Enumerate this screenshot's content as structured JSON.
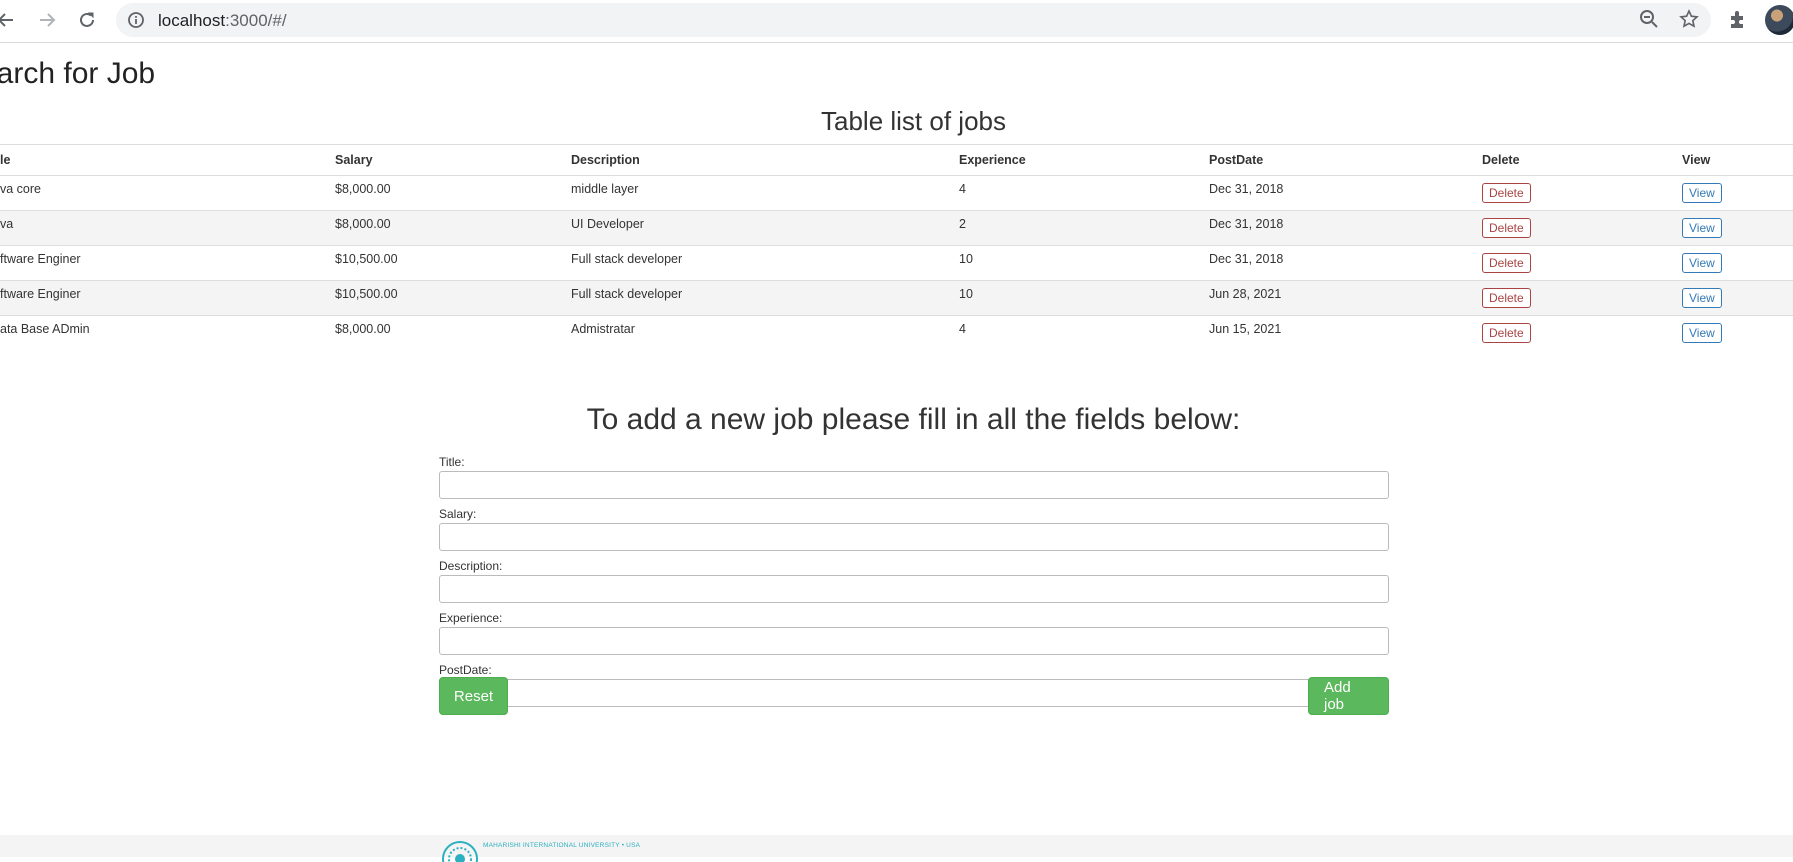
{
  "browser": {
    "url_host": "localhost",
    "url_rest": ":3000/#/",
    "icons": [
      "back-icon",
      "forward-icon",
      "reload-icon",
      "info-icon",
      "zoom-icon",
      "star-icon",
      "extensions-icon"
    ]
  },
  "page": {
    "heading": "earch for Job",
    "table_title": "Table list of jobs",
    "form_title": "To add a new job please fill in all the fields below:"
  },
  "table": {
    "headers": {
      "title": "le",
      "salary": "Salary",
      "description": "Description",
      "experience": "Experience",
      "postdate": "PostDate",
      "delete": "Delete",
      "view": "View"
    },
    "rows": [
      {
        "title": "va core",
        "salary": "$8,000.00",
        "description": "middle layer",
        "experience": "4",
        "postdate": "Dec 31, 2018",
        "delete": "Delete",
        "view": "View"
      },
      {
        "title": "va",
        "salary": "$8,000.00",
        "description": "UI Developer",
        "experience": "2",
        "postdate": "Dec 31, 2018",
        "delete": "Delete",
        "view": "View"
      },
      {
        "title": "ftware Enginer",
        "salary": "$10,500.00",
        "description": "Full stack developer",
        "experience": "10",
        "postdate": "Dec 31, 2018",
        "delete": "Delete",
        "view": "View"
      },
      {
        "title": "ftware Enginer",
        "salary": "$10,500.00",
        "description": "Full stack developer",
        "experience": "10",
        "postdate": "Jun 28, 2021",
        "delete": "Delete",
        "view": "View"
      },
      {
        "title": "ata Base ADmin",
        "salary": "$8,000.00",
        "description": "Admistratar",
        "experience": "4",
        "postdate": "Jun 15, 2021",
        "delete": "Delete",
        "view": "View"
      }
    ]
  },
  "form": {
    "title_label": "Title:",
    "title_value": "",
    "salary_label": "Salary:",
    "salary_value": "",
    "description_label": "Description:",
    "description_value": "",
    "experience_label": "Experience:",
    "experience_value": "",
    "postdate_label": "PostDate:",
    "postdate_value": "",
    "reset_label": "Reset",
    "add_label": "Add job"
  },
  "footer": {
    "logo_text": "MAHARISHI INTERNATIONAL UNIVERSITY • USA"
  },
  "colors": {
    "green_button": "#5cb85c",
    "delete_red": "#a94442",
    "view_blue": "#337ab7",
    "footer_teal": "#2ab0c0"
  }
}
